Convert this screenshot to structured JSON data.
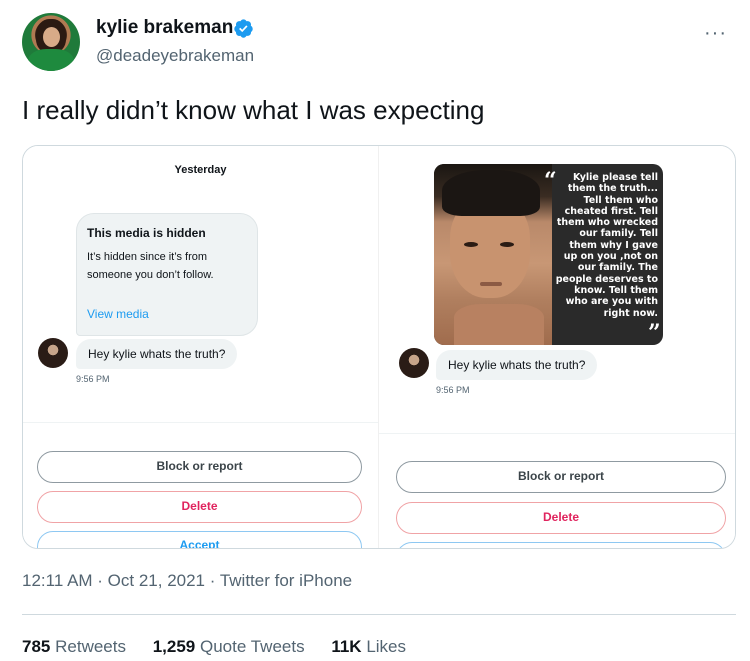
{
  "author": {
    "name": "kylie brakeman",
    "handle": "@deadeyebrakeman",
    "verified_icon": "verified-badge-icon",
    "more_label": "···"
  },
  "tweet": {
    "text": "I really didn’t know what I was expecting"
  },
  "screenshot_left": {
    "date_label": "Yesterday",
    "hidden_media": {
      "title": "This media is hidden",
      "text_line1": "It’s hidden since it’s from",
      "text_line2": "someone you don’t follow.",
      "link": "View media"
    },
    "message": "Hey kylie whats the truth?",
    "time": "9:56 PM",
    "buttons": {
      "block": "Block or report",
      "delete": "Delete",
      "accept": "Accept"
    }
  },
  "screenshot_right": {
    "quote_lines": [
      "Kylie please tell",
      "them the truth...",
      "Tell them who",
      "cheated first. Tell",
      "them who wrecked",
      "our family. Tell",
      "them why I gave",
      "up on you ,not on",
      "our family. The",
      "people deserves to",
      "know. Tell them",
      "who are you with",
      "right now."
    ],
    "message": "Hey kylie whats the truth?",
    "time": "9:56 PM",
    "buttons": {
      "block": "Block or report",
      "delete": "Delete"
    }
  },
  "meta": {
    "timestamp": "12:11 AM · Oct 21, 2021 · Twitter for iPhone"
  },
  "stats": {
    "retweets_count": "785",
    "retweets_label": "Retweets",
    "quotes_count": "1,259",
    "quotes_label": "Quote Tweets",
    "likes_count": "11K",
    "likes_label": "Likes"
  },
  "colors": {
    "link_blue": "#1d9bf0",
    "delete_red": "#e0245e",
    "secondary_text": "#536471"
  }
}
